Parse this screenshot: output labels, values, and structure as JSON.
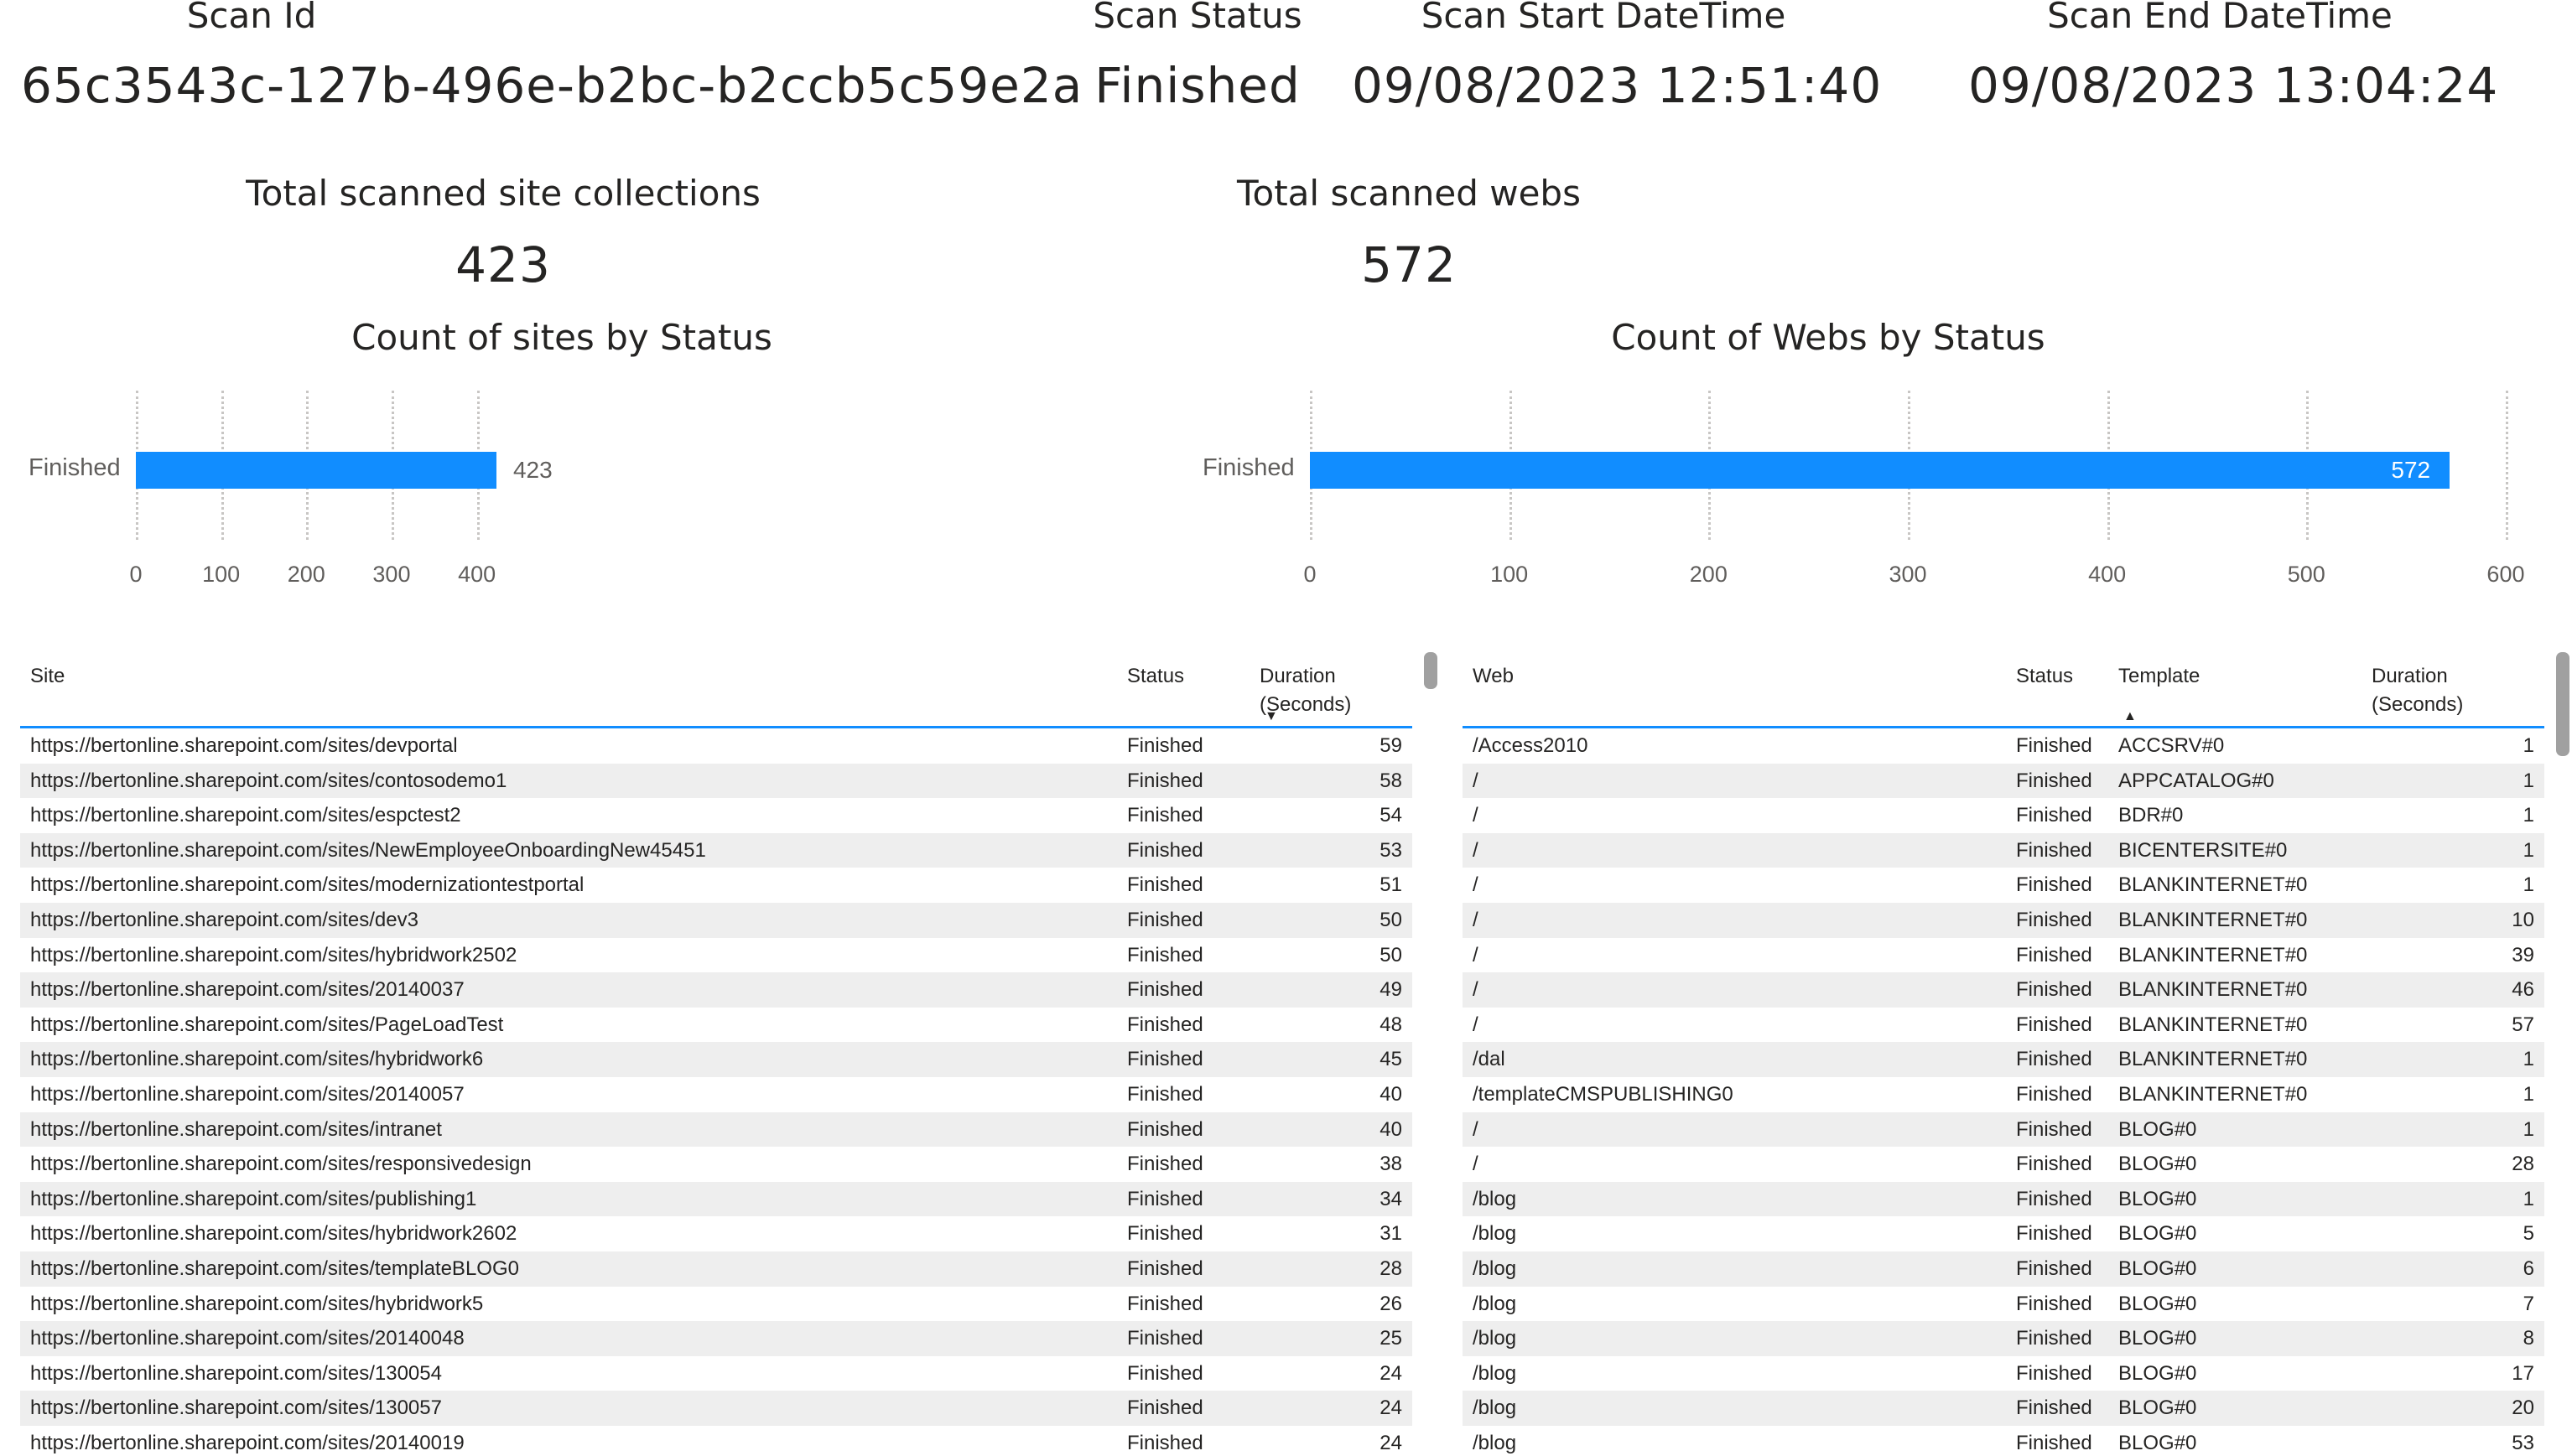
{
  "cards": {
    "scan_id": {
      "label": "Scan Id",
      "value": "65c3543c-127b-496e-b2bc-b2ccb5c59e2a"
    },
    "scan_status": {
      "label": "Scan Status",
      "value": "Finished"
    },
    "scan_start": {
      "label": "Scan Start DateTime",
      "value": "09/08/2023 12:51:40"
    },
    "scan_end": {
      "label": "Scan End DateTime",
      "value": "09/08/2023 13:04:24"
    },
    "total_sites": {
      "label": "Total scanned site collections",
      "value": "423"
    },
    "total_webs": {
      "label": "Total scanned webs",
      "value": "572"
    }
  },
  "colors": {
    "bar": "#118dff",
    "header_underline": "#118dff",
    "row_alt": "#eeeeee"
  },
  "chart_data": [
    {
      "type": "bar",
      "orientation": "horizontal",
      "title": "Count of sites by Status",
      "categories": [
        "Finished"
      ],
      "values": [
        423
      ],
      "data_labels": [
        "423"
      ],
      "xlim": [
        0,
        450
      ],
      "xticks": [
        0,
        100,
        200,
        300,
        400
      ],
      "xtick_labels": [
        "0",
        "100",
        "200",
        "300",
        "400"
      ],
      "grid": true
    },
    {
      "type": "bar",
      "orientation": "horizontal",
      "title": "Count of Webs by Status",
      "categories": [
        "Finished"
      ],
      "values": [
        572
      ],
      "data_labels": [
        "572"
      ],
      "xlim": [
        0,
        600
      ],
      "xticks": [
        0,
        100,
        200,
        300,
        400,
        500,
        600
      ],
      "xtick_labels": [
        "0",
        "100",
        "200",
        "300",
        "400",
        "500",
        "600"
      ],
      "grid": true
    }
  ],
  "sites_table": {
    "headers": {
      "site": "Site",
      "status": "Status",
      "duration_l1": "Duration",
      "duration_l2": "(Seconds)"
    },
    "sort_indicator": "▼",
    "rows": [
      [
        "https://bertonline.sharepoint.com/sites/devportal",
        "Finished",
        "59"
      ],
      [
        "https://bertonline.sharepoint.com/sites/contosodemo1",
        "Finished",
        "58"
      ],
      [
        "https://bertonline.sharepoint.com/sites/espctest2",
        "Finished",
        "54"
      ],
      [
        "https://bertonline.sharepoint.com/sites/NewEmployeeOnboardingNew45451",
        "Finished",
        "53"
      ],
      [
        "https://bertonline.sharepoint.com/sites/modernizationtestportal",
        "Finished",
        "51"
      ],
      [
        "https://bertonline.sharepoint.com/sites/dev3",
        "Finished",
        "50"
      ],
      [
        "https://bertonline.sharepoint.com/sites/hybridwork2502",
        "Finished",
        "50"
      ],
      [
        "https://bertonline.sharepoint.com/sites/20140037",
        "Finished",
        "49"
      ],
      [
        "https://bertonline.sharepoint.com/sites/PageLoadTest",
        "Finished",
        "48"
      ],
      [
        "https://bertonline.sharepoint.com/sites/hybridwork6",
        "Finished",
        "45"
      ],
      [
        "https://bertonline.sharepoint.com/sites/20140057",
        "Finished",
        "40"
      ],
      [
        "https://bertonline.sharepoint.com/sites/intranet",
        "Finished",
        "40"
      ],
      [
        "https://bertonline.sharepoint.com/sites/responsivedesign",
        "Finished",
        "38"
      ],
      [
        "https://bertonline.sharepoint.com/sites/publishing1",
        "Finished",
        "34"
      ],
      [
        "https://bertonline.sharepoint.com/sites/hybridwork2602",
        "Finished",
        "31"
      ],
      [
        "https://bertonline.sharepoint.com/sites/templateBLOG0",
        "Finished",
        "28"
      ],
      [
        "https://bertonline.sharepoint.com/sites/hybridwork5",
        "Finished",
        "26"
      ],
      [
        "https://bertonline.sharepoint.com/sites/20140048",
        "Finished",
        "25"
      ],
      [
        "https://bertonline.sharepoint.com/sites/130054",
        "Finished",
        "24"
      ],
      [
        "https://bertonline.sharepoint.com/sites/130057",
        "Finished",
        "24"
      ],
      [
        "https://bertonline.sharepoint.com/sites/20140019",
        "Finished",
        "24"
      ]
    ]
  },
  "webs_table": {
    "headers": {
      "web": "Web",
      "status": "Status",
      "template": "Template",
      "duration_l1": "Duration",
      "duration_l2": "(Seconds)"
    },
    "sort_indicator": "▲",
    "rows": [
      [
        "/Access2010",
        "Finished",
        "ACCSRV#0",
        "1"
      ],
      [
        "/",
        "Finished",
        "APPCATALOG#0",
        "1"
      ],
      [
        "/",
        "Finished",
        "BDR#0",
        "1"
      ],
      [
        "/",
        "Finished",
        "BICENTERSITE#0",
        "1"
      ],
      [
        "/",
        "Finished",
        "BLANKINTERNET#0",
        "1"
      ],
      [
        "/",
        "Finished",
        "BLANKINTERNET#0",
        "10"
      ],
      [
        "/",
        "Finished",
        "BLANKINTERNET#0",
        "39"
      ],
      [
        "/",
        "Finished",
        "BLANKINTERNET#0",
        "46"
      ],
      [
        "/",
        "Finished",
        "BLANKINTERNET#0",
        "57"
      ],
      [
        "/dal",
        "Finished",
        "BLANKINTERNET#0",
        "1"
      ],
      [
        "/templateCMSPUBLISHING0",
        "Finished",
        "BLANKINTERNET#0",
        "1"
      ],
      [
        "/",
        "Finished",
        "BLOG#0",
        "1"
      ],
      [
        "/",
        "Finished",
        "BLOG#0",
        "28"
      ],
      [
        "/blog",
        "Finished",
        "BLOG#0",
        "1"
      ],
      [
        "/blog",
        "Finished",
        "BLOG#0",
        "5"
      ],
      [
        "/blog",
        "Finished",
        "BLOG#0",
        "6"
      ],
      [
        "/blog",
        "Finished",
        "BLOG#0",
        "7"
      ],
      [
        "/blog",
        "Finished",
        "BLOG#0",
        "8"
      ],
      [
        "/blog",
        "Finished",
        "BLOG#0",
        "17"
      ],
      [
        "/blog",
        "Finished",
        "BLOG#0",
        "20"
      ],
      [
        "/blog",
        "Finished",
        "BLOG#0",
        "53"
      ]
    ]
  }
}
